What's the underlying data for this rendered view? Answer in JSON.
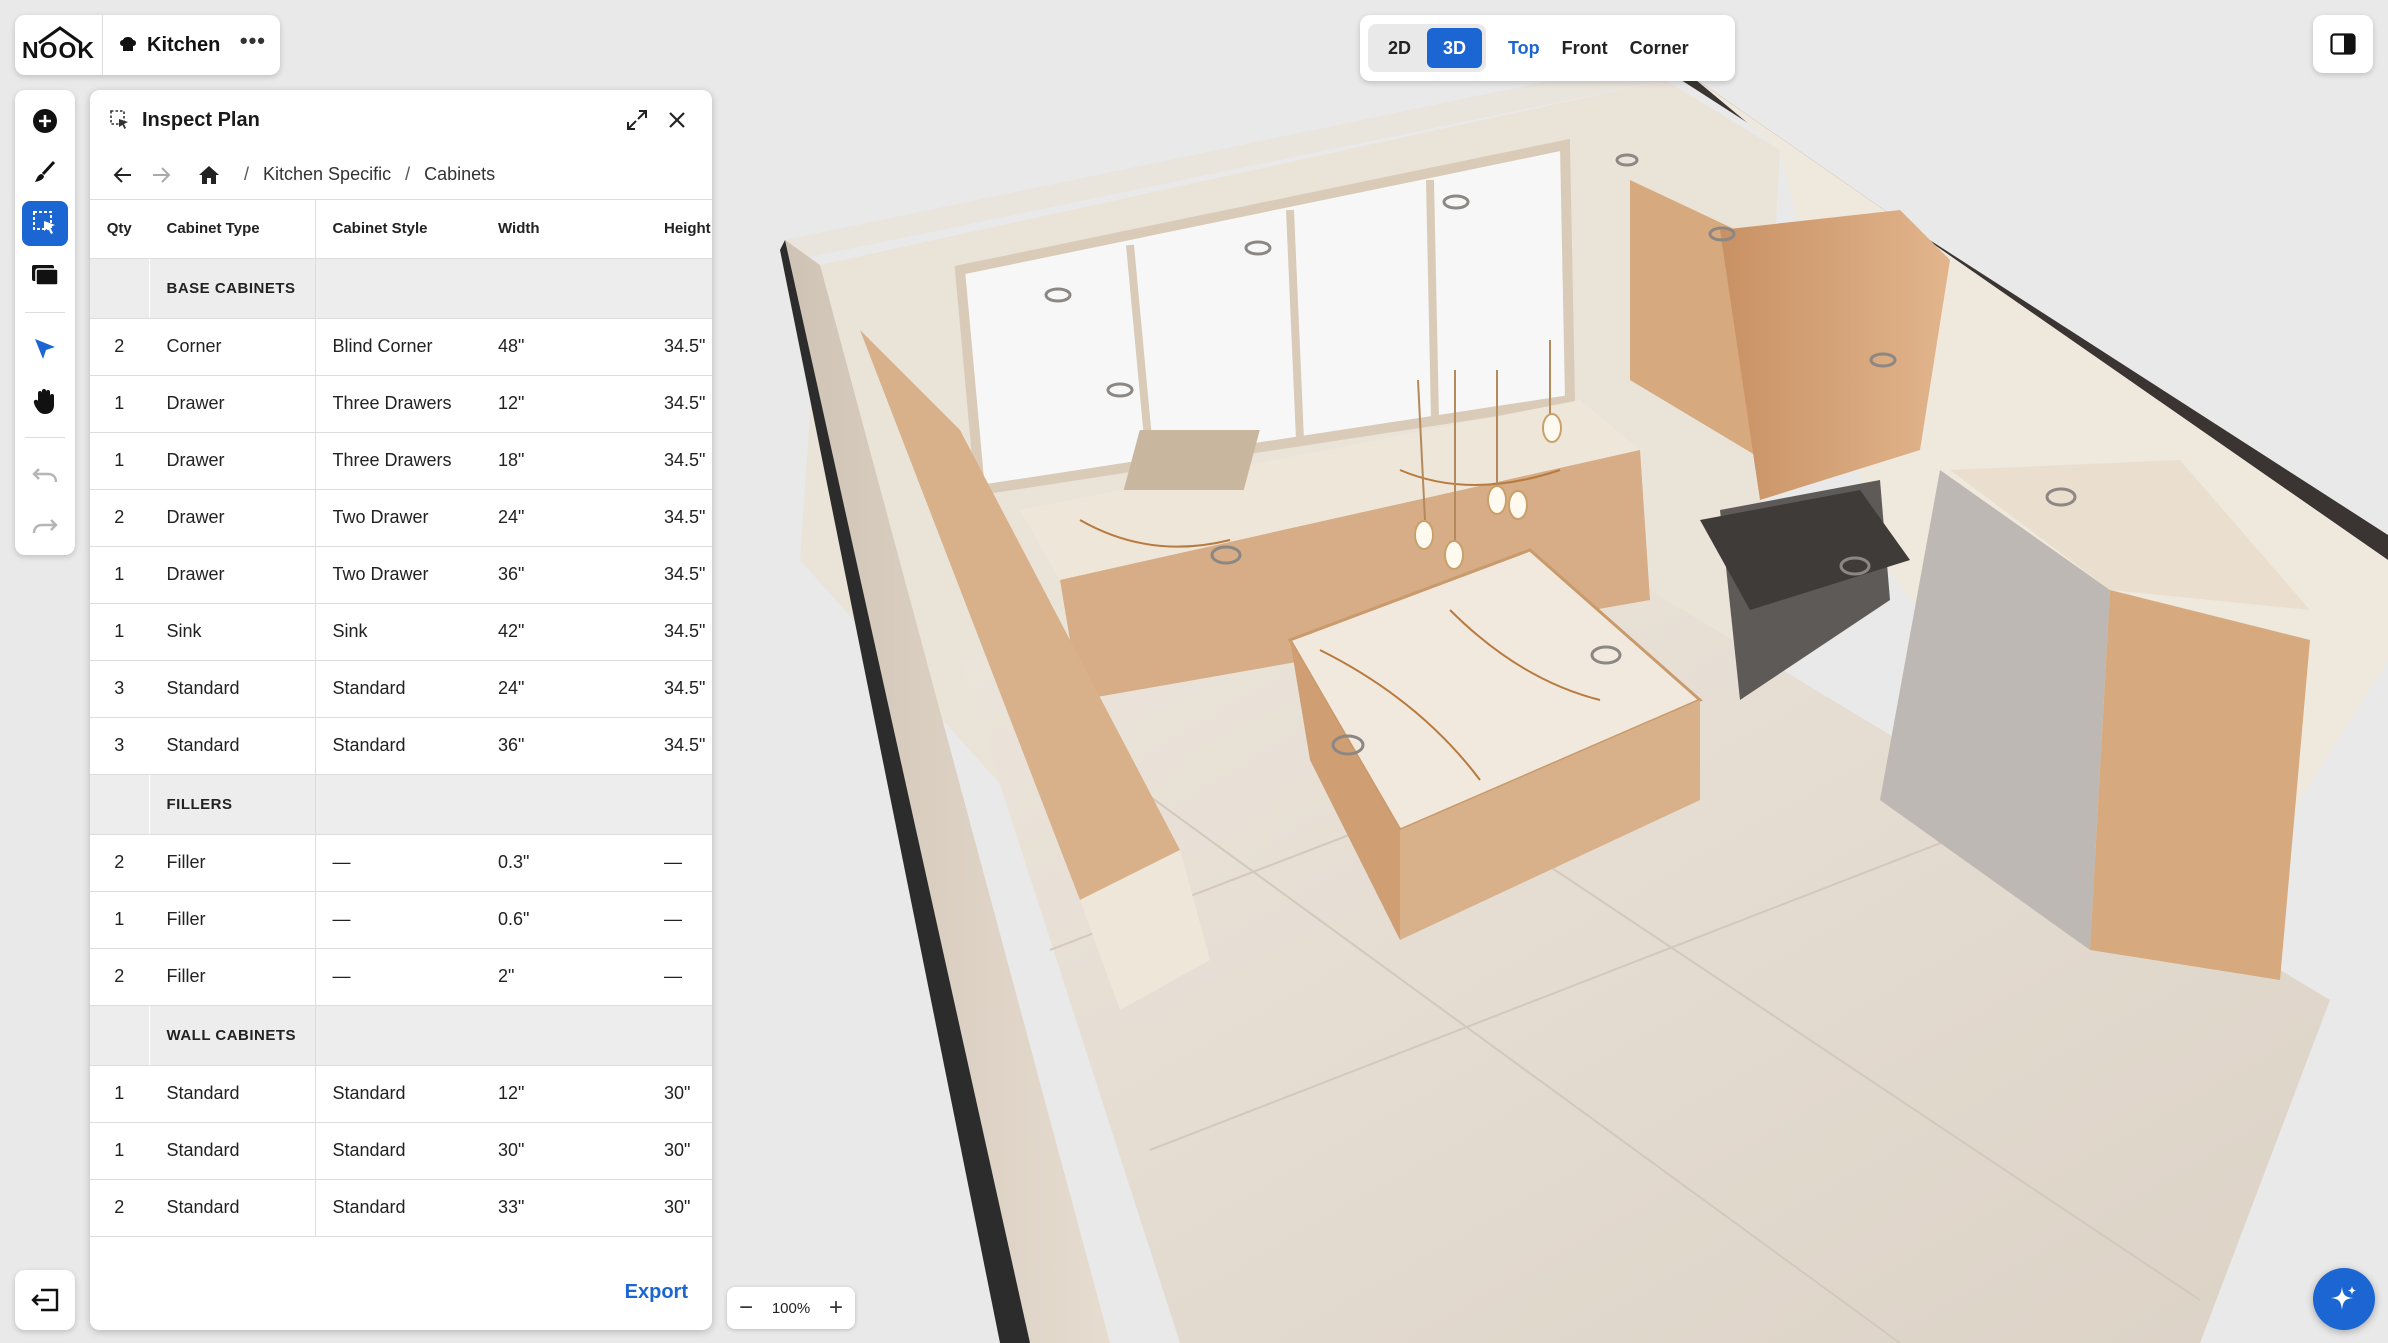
{
  "app": {
    "logo": "NOOK",
    "project_name": "Kitchen",
    "more_label": "•••"
  },
  "toolbar": {
    "tools": [
      "add-icon",
      "paint-brush-icon",
      "select-inspect-icon",
      "library-icon",
      "pointer-icon",
      "hand-pan-icon"
    ],
    "history": [
      "undo-icon",
      "redo-icon"
    ],
    "exit": "exit-icon"
  },
  "panel": {
    "title": "Inspect Plan",
    "breadcrumb": [
      "Kitchen Specific",
      "Cabinets"
    ],
    "columns": [
      "Qty",
      "Cabinet Type",
      "Cabinet Style",
      "Width",
      "Height"
    ],
    "sections": [
      {
        "name": "BASE CABINETS",
        "rows": [
          {
            "qty": "2",
            "type": "Corner",
            "style": "Blind Corner",
            "width": "48\"",
            "height": "34.5\""
          },
          {
            "qty": "1",
            "type": "Drawer",
            "style": "Three Drawers",
            "width": "12\"",
            "height": "34.5\""
          },
          {
            "qty": "1",
            "type": "Drawer",
            "style": "Three Drawers",
            "width": "18\"",
            "height": "34.5\""
          },
          {
            "qty": "2",
            "type": "Drawer",
            "style": "Two Drawer",
            "width": "24\"",
            "height": "34.5\""
          },
          {
            "qty": "1",
            "type": "Drawer",
            "style": "Two Drawer",
            "width": "36\"",
            "height": "34.5\""
          },
          {
            "qty": "1",
            "type": "Sink",
            "style": "Sink",
            "width": "42\"",
            "height": "34.5\""
          },
          {
            "qty": "3",
            "type": "Standard",
            "style": "Standard",
            "width": "24\"",
            "height": "34.5\""
          },
          {
            "qty": "3",
            "type": "Standard",
            "style": "Standard",
            "width": "36\"",
            "height": "34.5\""
          }
        ]
      },
      {
        "name": "FILLERS",
        "rows": [
          {
            "qty": "2",
            "type": "Filler",
            "style": "—",
            "width": "0.3\"",
            "height": "—"
          },
          {
            "qty": "1",
            "type": "Filler",
            "style": "—",
            "width": "0.6\"",
            "height": "—"
          },
          {
            "qty": "2",
            "type": "Filler",
            "style": "—",
            "width": "2\"",
            "height": "—"
          }
        ]
      },
      {
        "name": "WALL CABINETS",
        "rows": [
          {
            "qty": "1",
            "type": "Standard",
            "style": "Standard",
            "width": "12\"",
            "height": "30\""
          },
          {
            "qty": "1",
            "type": "Standard",
            "style": "Standard",
            "width": "30\"",
            "height": "30\""
          },
          {
            "qty": "2",
            "type": "Standard",
            "style": "Standard",
            "width": "33\"",
            "height": "30\""
          }
        ]
      }
    ],
    "export_label": "Export"
  },
  "views": {
    "modes": [
      {
        "label": "2D",
        "active": false
      },
      {
        "label": "3D",
        "active": true
      }
    ],
    "cameras": [
      {
        "label": "Top",
        "active": true
      },
      {
        "label": "Front",
        "active": false
      },
      {
        "label": "Corner",
        "active": false
      }
    ]
  },
  "zoom": {
    "value": "100%",
    "minus": "−",
    "plus": "+"
  },
  "colors": {
    "accent": "#1b66d2",
    "wood": "#d8b08a",
    "marble": "#efe6da",
    "floor": "#e6ddd2"
  }
}
